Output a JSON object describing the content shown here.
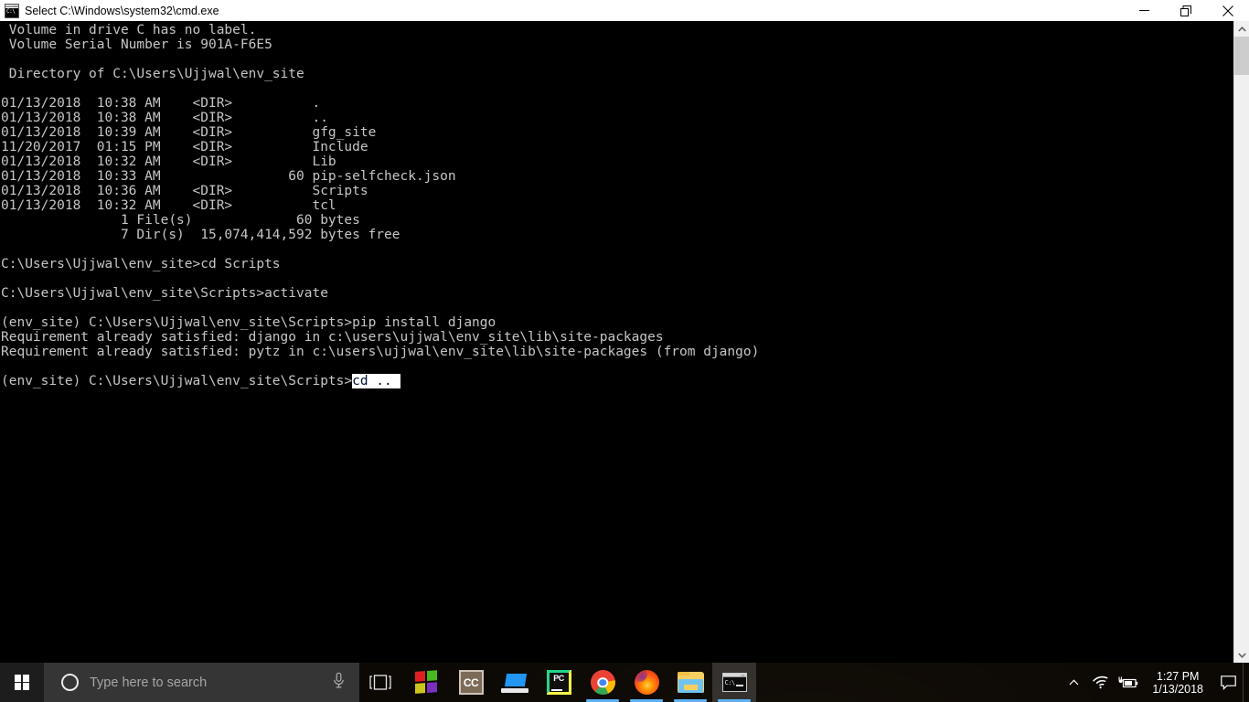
{
  "window": {
    "title": "Select C:\\Windows\\system32\\cmd.exe",
    "icon": "cmd-window-icon",
    "minimize_label": "Minimize",
    "maximize_label": "Restore",
    "close_label": "Close",
    "background_color": "#000000",
    "text_color": "#c6c6c6",
    "titlebar_color": "#ffffff"
  },
  "console": {
    "selection_color": "#ffffff",
    "selection_text_color": "#001030",
    "lines": [
      " Volume in drive C has no label.",
      " Volume Serial Number is 901A-F6E5",
      "",
      " Directory of C:\\Users\\Ujjwal\\env_site",
      "",
      "01/13/2018  10:38 AM    <DIR>          .",
      "01/13/2018  10:38 AM    <DIR>          ..",
      "01/13/2018  10:39 AM    <DIR>          gfg_site",
      "11/20/2017  01:15 PM    <DIR>          Include",
      "01/13/2018  10:32 AM    <DIR>          Lib",
      "01/13/2018  10:33 AM                60 pip-selfcheck.json",
      "01/13/2018  10:36 AM    <DIR>          Scripts",
      "01/13/2018  10:32 AM    <DIR>          tcl",
      "               1 File(s)             60 bytes",
      "               7 Dir(s)  15,074,414,592 bytes free",
      "",
      "C:\\Users\\Ujjwal\\env_site>cd Scripts",
      "",
      "C:\\Users\\Ujjwal\\env_site\\Scripts>activate",
      "",
      "(env_site) C:\\Users\\Ujjwal\\env_site\\Scripts>pip install django",
      "Requirement already satisfied: django in c:\\users\\ujjwal\\env_site\\lib\\site-packages",
      "Requirement already satisfied: pytz in c:\\users\\ujjwal\\env_site\\lib\\site-packages (from django)",
      ""
    ],
    "last_line": {
      "prompt": "(env_site) C:\\Users\\Ujjwal\\env_site\\Scripts>",
      "selected_text": "cd .. "
    }
  },
  "scrollbar": {
    "up_arrow": "chevron-up-icon",
    "down_arrow": "chevron-down-icon",
    "thumb_label": "scroll-thumb"
  },
  "taskbar": {
    "start_label": "Start",
    "search": {
      "placeholder": "Type here to search",
      "cortana_icon": "cortana-circle-icon",
      "mic_icon": "microphone-icon"
    },
    "taskview_label": "Task View",
    "apps": [
      {
        "name": "microsoft-store",
        "label": "Microsoft Store",
        "active": false,
        "running": false
      },
      {
        "name": "cc-app",
        "label": "CC",
        "active": false,
        "running": false
      },
      {
        "name": "teamviewer",
        "label": "TeamViewer",
        "active": false,
        "running": false
      },
      {
        "name": "pycharm",
        "label": "PyCharm",
        "active": false,
        "running": false
      },
      {
        "name": "google-chrome",
        "label": "Google Chrome",
        "active": false,
        "running": true
      },
      {
        "name": "mozilla-firefox",
        "label": "Mozilla Firefox",
        "active": false,
        "running": true
      },
      {
        "name": "file-explorer",
        "label": "File Explorer",
        "active": false,
        "running": true
      },
      {
        "name": "command-prompt",
        "label": "Command Prompt",
        "active": true,
        "running": true
      }
    ],
    "tray": {
      "chevron_icon": "chevron-up-icon",
      "wifi_icon": "wifi-icon",
      "battery_icon": "battery-charging-icon",
      "time": "1:27 PM",
      "date": "1/13/2018",
      "action_center_icon": "action-center-icon",
      "show_desktop_label": "Show desktop"
    },
    "accent_color": "#5eb1f0"
  }
}
